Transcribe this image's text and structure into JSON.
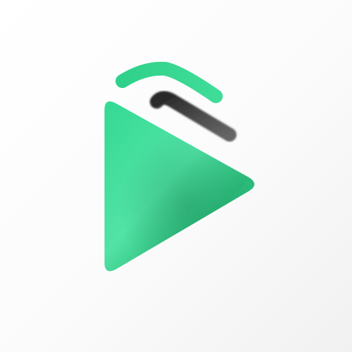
{
  "logo": {
    "icon": "play-triangle-logo-icon",
    "colors": {
      "background": "#fafafa",
      "primary_green": "#2fd18a",
      "light_green": "#55e3a7",
      "dark_green": "#24a86c",
      "dark_bar": "#3a3a3a"
    }
  }
}
